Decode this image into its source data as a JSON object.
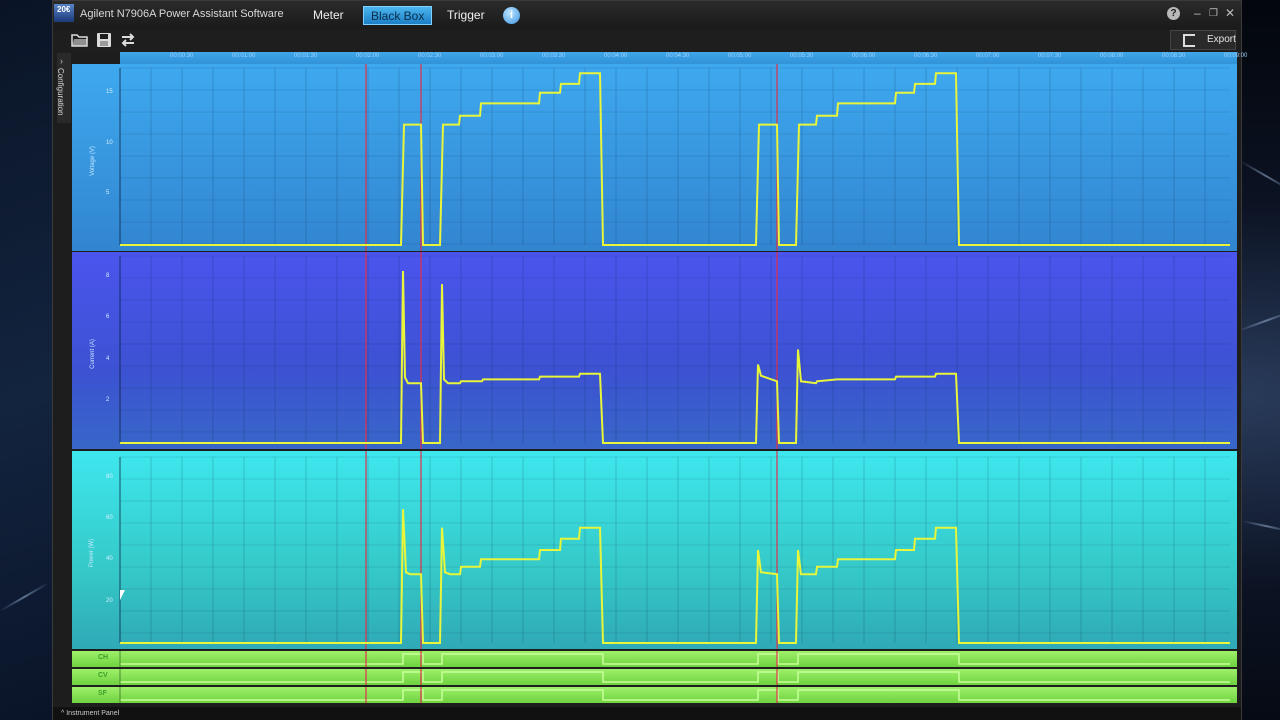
{
  "window": {
    "logo_text": "20€",
    "title": "Agilent N7906A Power Assistant Software"
  },
  "nav": {
    "tabs": [
      {
        "label": "Meter",
        "active": false
      },
      {
        "label": "Black Box",
        "active": true
      },
      {
        "label": "Trigger",
        "active": false
      }
    ]
  },
  "window_controls": {
    "help": "?",
    "minimize": "–",
    "restore": "❐",
    "close": "✕"
  },
  "toolbar": {
    "open_icon": "folder-open-icon",
    "save_icon": "save-icon",
    "swap_icon": "swap-icon",
    "export_label": "Export"
  },
  "sidebar": {
    "config_label": "Configuration"
  },
  "ruler": {
    "ticks": [
      "00:00:30",
      "00:01:00",
      "00:01:30",
      "00:02:00",
      "00:02:30",
      "00:03:00",
      "00:03:30",
      "00:04:00",
      "00:04:30",
      "00:05:00",
      "00:05:30",
      "00:06:00",
      "00:06:30",
      "00:07:00",
      "00:07:30",
      "00:08:00",
      "00:08:30",
      "00:09:00"
    ]
  },
  "panels": [
    {
      "id": "voltage",
      "ylabel": "Voltage (V)",
      "ticks": [
        "15",
        "10",
        "5"
      ]
    },
    {
      "id": "current",
      "ylabel": "Current (A)",
      "ticks": [
        "8",
        "6",
        "4",
        "2"
      ]
    },
    {
      "id": "power",
      "ylabel": "Power (W)",
      "ticks": [
        "80",
        "60",
        "40",
        "20"
      ]
    }
  ],
  "status_rows": [
    {
      "label": "CH"
    },
    {
      "label": "CV"
    },
    {
      "label": "SF"
    }
  ],
  "footer": {
    "label": "Instrument Panel"
  },
  "colors": {
    "trace": "#e8f53a",
    "marker": "#e0304a",
    "status": "#8de85a"
  }
}
